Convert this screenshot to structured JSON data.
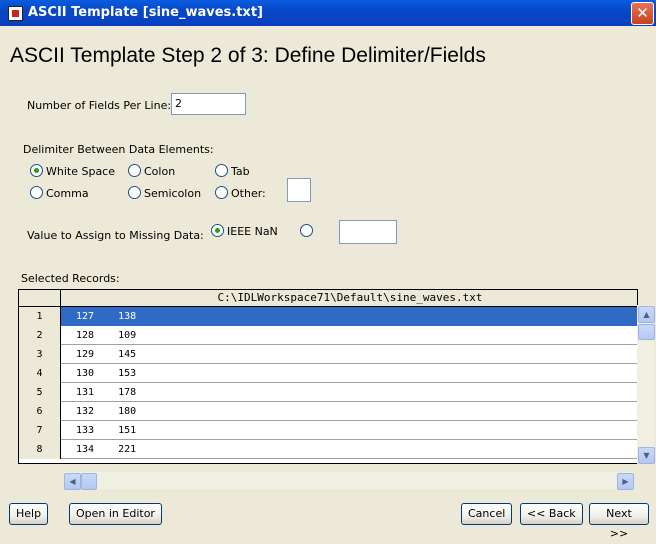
{
  "window": {
    "title": "ASCII Template [sine_waves.txt]",
    "close_glyph": "✕"
  },
  "heading": "ASCII Template Step 2 of 3: Define Delimiter/Fields",
  "fields": {
    "label": "Number of Fields Per Line:",
    "value": "2"
  },
  "delimiter": {
    "label": "Delimiter Between Data Elements:",
    "options": [
      {
        "label": "White Space",
        "selected": true
      },
      {
        "label": "Colon",
        "selected": false
      },
      {
        "label": "Tab",
        "selected": false
      },
      {
        "label": "Comma",
        "selected": false
      },
      {
        "label": "Semicolon",
        "selected": false
      },
      {
        "label": "Other:",
        "selected": false
      }
    ],
    "other_value": ""
  },
  "missing": {
    "label": "Value to Assign to Missing Data:",
    "ieee_label": "IEEE NaN",
    "ieee_selected": true,
    "custom_value": ""
  },
  "records": {
    "label": "Selected Records:",
    "column_header": "C:\\IDLWorkspace71\\Default\\sine_waves.txt",
    "rows": [
      {
        "num": "1",
        "text": "127    138",
        "selected": true
      },
      {
        "num": "2",
        "text": "128    109",
        "selected": false
      },
      {
        "num": "3",
        "text": "129    145",
        "selected": false
      },
      {
        "num": "4",
        "text": "130    153",
        "selected": false
      },
      {
        "num": "5",
        "text": "131    178",
        "selected": false
      },
      {
        "num": "6",
        "text": "132    180",
        "selected": false
      },
      {
        "num": "7",
        "text": "133    151",
        "selected": false
      },
      {
        "num": "8",
        "text": "134    221",
        "selected": false
      }
    ]
  },
  "buttons": {
    "help": "Help",
    "open_editor": "Open in Editor",
    "cancel": "Cancel",
    "back": "<< Back",
    "next": "Next >>"
  },
  "colors": {
    "titlebar": "#0a5ce0",
    "selection": "#316ac5",
    "background": "#ece9d8"
  }
}
